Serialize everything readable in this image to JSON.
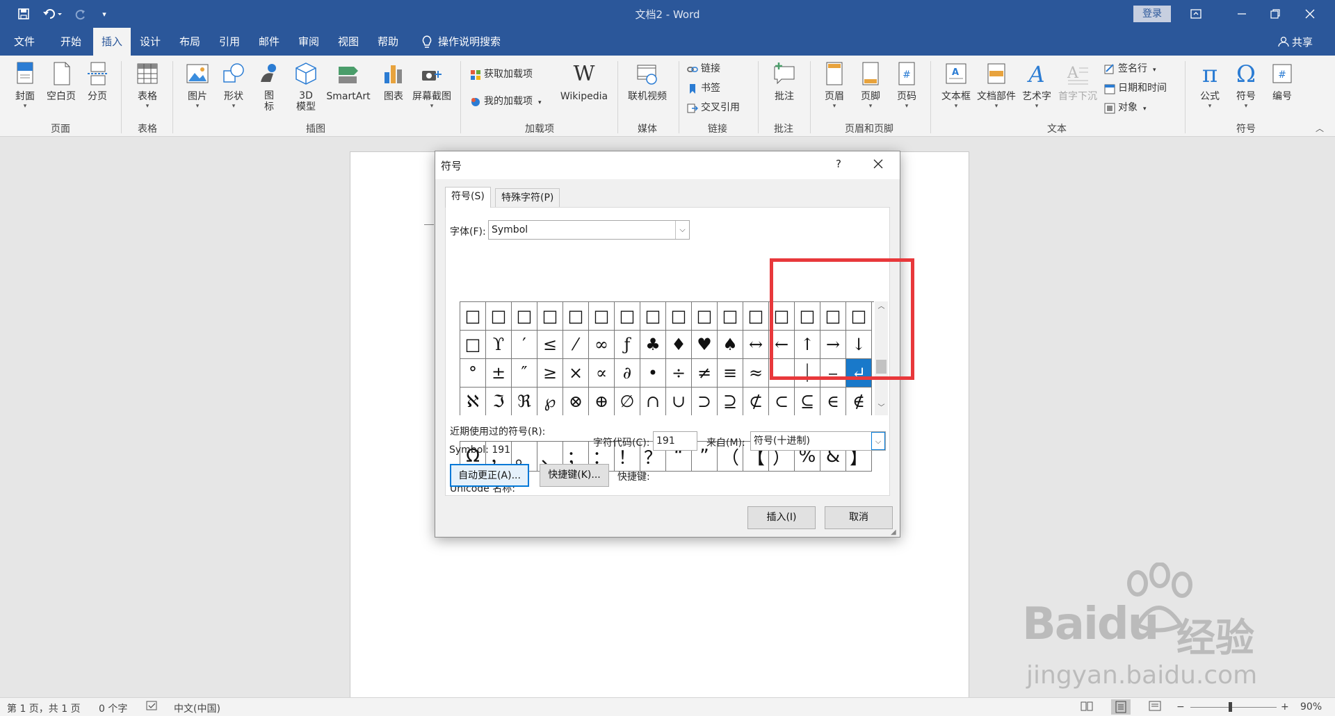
{
  "app": {
    "doc_title": "文档2 - Word",
    "login_label": "登录",
    "share_label": "共享"
  },
  "tabs": [
    "文件",
    "开始",
    "插入",
    "设计",
    "布局",
    "引用",
    "邮件",
    "审阅",
    "视图",
    "帮助"
  ],
  "tellme": "操作说明搜索",
  "ribbon": {
    "groups": {
      "page": "页面",
      "table": "表格",
      "illustrations": "插图",
      "addins": "加载项",
      "media": "媒体",
      "links": "链接",
      "comments": "批注",
      "header_footer": "页眉和页脚",
      "text": "文本",
      "symbols": "符号"
    },
    "buttons": {
      "cover": "封面",
      "blank_page": "空白页",
      "page_break": "分页",
      "table": "表格",
      "pictures": "图片",
      "shapes": "形状",
      "icons": "图标",
      "model3d": "3D 模型",
      "smartart": "SmartArt",
      "chart": "图表",
      "screenshot": "屏幕截图",
      "get_addins": "获取加载项",
      "my_addins": "我的加载项",
      "wikipedia": "Wikipedia",
      "online_video": "联机视频",
      "link": "链接",
      "bookmark": "书签",
      "cross_ref": "交叉引用",
      "comment": "批注",
      "header": "页眉",
      "footer": "页脚",
      "page_number": "页码",
      "textbox": "文本框",
      "quick_parts": "文档部件",
      "wordart": "艺术字",
      "dropcap": "首字下沉",
      "signature": "签名行",
      "datetime": "日期和时间",
      "object": "对象",
      "equation": "公式",
      "symbol": "符号",
      "number": "编号"
    }
  },
  "dialog": {
    "title": "符号",
    "help": "?",
    "tab_symbols": "符号(S)",
    "tab_special": "特殊字符(P)",
    "font_label": "字体(F):",
    "font_value": "Symbol",
    "grid": [
      [
        "□",
        "□",
        "□",
        "□",
        "□",
        "□",
        "□",
        "□",
        "□",
        "□",
        "□",
        "□",
        "□",
        "□",
        "□",
        "□"
      ],
      [
        "□",
        "ϒ",
        "′",
        "≤",
        "⁄",
        "∞",
        "ƒ",
        "♣",
        "♦",
        "♥",
        "♠",
        "↔",
        "←",
        "↑",
        "→",
        "↓"
      ],
      [
        "°",
        "±",
        "″",
        "≥",
        "×",
        "∝",
        "∂",
        "•",
        "÷",
        "≠",
        "≡",
        "≈",
        "…",
        "⏐",
        "⎯",
        "↵"
      ],
      [
        "ℵ",
        "ℑ",
        "ℜ",
        "℘",
        "⊗",
        "⊕",
        "∅",
        "∩",
        "∪",
        "⊃",
        "⊇",
        "⊄",
        "⊂",
        "⊆",
        "∈",
        "∉"
      ]
    ],
    "selected": {
      "row": 2,
      "col": 15
    },
    "recent_label": "近期使用过的符号(R):",
    "recent": [
      "Ω",
      "，",
      "。",
      "、",
      "；",
      "：",
      "！",
      "？",
      "“",
      "”",
      "（",
      "【",
      "）",
      "%",
      "&",
      "】"
    ],
    "unicode_label": "Unicode 名称:",
    "symbol_code_text": "Symbol: 191",
    "char_code_label": "字符代码(C):",
    "char_code_value": "191",
    "from_label": "来自(M):",
    "from_value": "符号(十进制)",
    "autocorrect_btn": "自动更正(A)...",
    "shortcut_btn": "快捷键(K)...",
    "shortcut_label": "快捷键:",
    "insert_btn": "插入(I)",
    "cancel_btn": "取消"
  },
  "status": {
    "page": "第 1 页，共 1 页",
    "words": "0 个字",
    "lang": "中文(中国)",
    "zoom": "90%"
  },
  "watermark": {
    "brand": "Baidu",
    "brand_cn": "经验",
    "url": "jingyan.baidu.com"
  },
  "colors": {
    "accent": "#2b579a",
    "selection": "#1979ca",
    "highlight_box": "#e8383b"
  }
}
